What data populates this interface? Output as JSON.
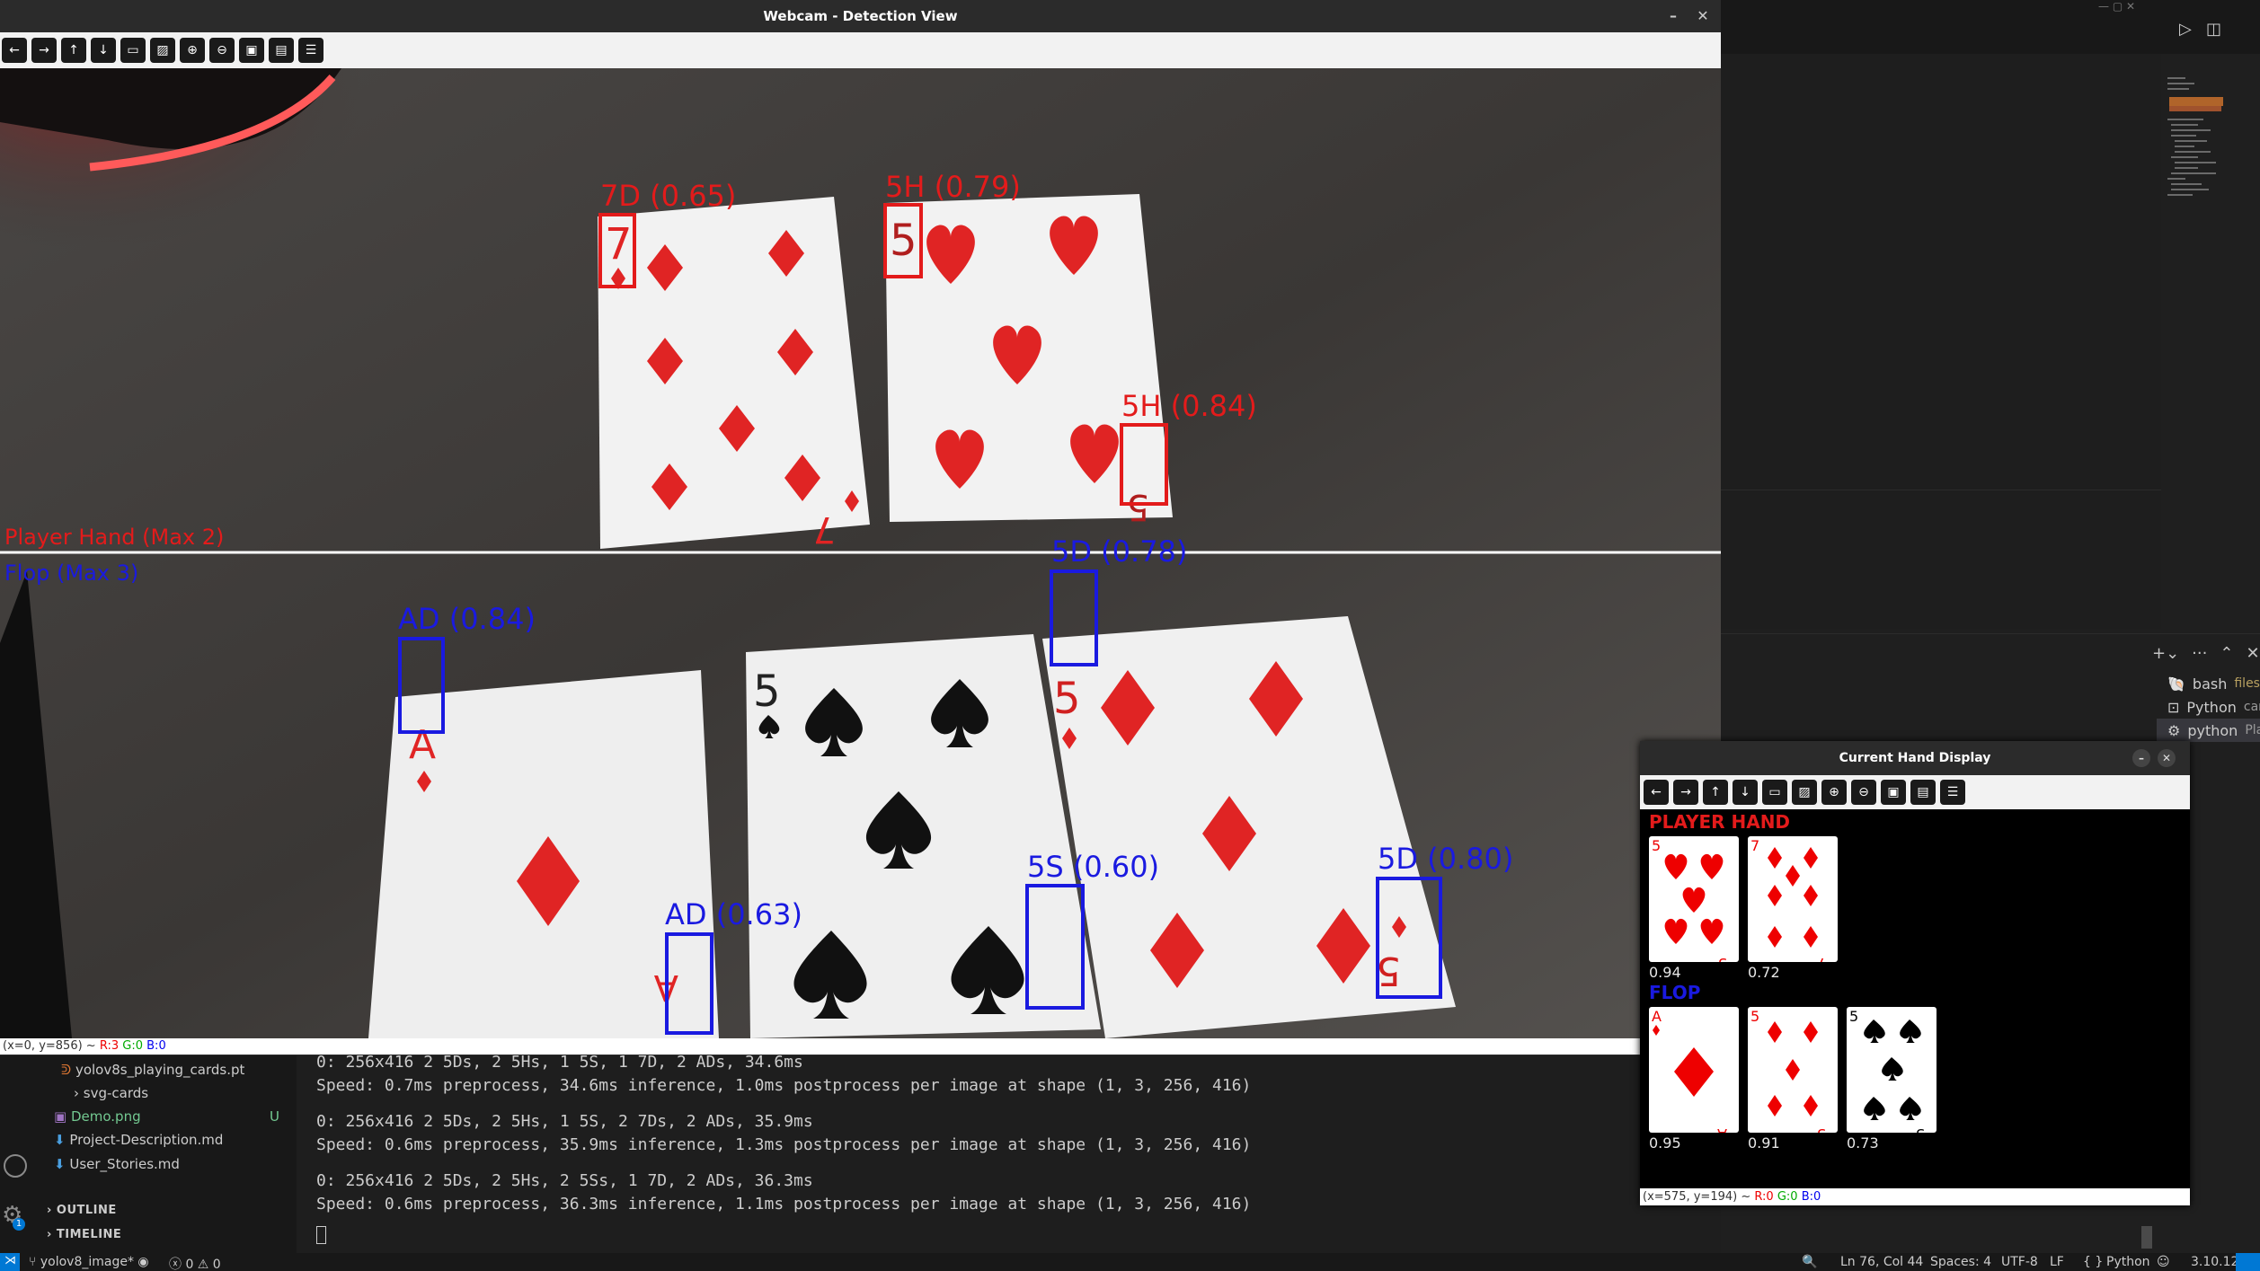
{
  "webcam_window": {
    "title": "Webcam - Detection View",
    "status_text": "(x=0, y=856) ~ ",
    "status_r": "R:3",
    "status_g": "G:0",
    "status_b": "B:0"
  },
  "zones": {
    "player": "Player Hand (Max 2)",
    "flop": "Flop (Max 3)"
  },
  "detections": {
    "d1": "7D (0.65)",
    "d2": "5H (0.79)",
    "d3": "5H (0.84)",
    "d4": "5D (0.78)",
    "d5": "AD (0.84)",
    "d6": "AD (0.63)",
    "d7": "5S (0.60)",
    "d8": "5D (0.80)"
  },
  "hand_window": {
    "title": "Current Hand Display",
    "player_label": "PLAYER HAND",
    "flop_label": "FLOP",
    "player_confs": [
      "0.94",
      "0.72"
    ],
    "flop_confs": [
      "0.95",
      "0.91",
      "0.73"
    ],
    "player_cards": [
      {
        "rank": "5",
        "suit": "hearts"
      },
      {
        "rank": "7",
        "suit": "diamonds"
      }
    ],
    "flop_cards": [
      {
        "rank": "A",
        "suit": "diamonds"
      },
      {
        "rank": "5",
        "suit": "diamonds"
      },
      {
        "rank": "5",
        "suit": "spades"
      }
    ],
    "status_text": "(x=575, y=194) ~ ",
    "status_r": "R:0",
    "status_g": "G:0",
    "status_b": "B:0"
  },
  "explorer": {
    "files": [
      "yolov8s_playing_cards.pt",
      "svg-cards",
      "Demo.png",
      "Project-Description.md",
      "User_Stories.md"
    ],
    "demo_badge": "U",
    "outline": "OUTLINE",
    "timeline": "TIMELINE"
  },
  "terminal": {
    "lines": [
      "0: 256x416 2 5Ds, 2 5Hs, 1 5S, 1 7D, 2 ADs, 34.6ms",
      "Speed: 0.7ms preprocess, 34.6ms inference, 1.0ms postprocess per image at shape (1, 3, 256, 416)",
      "0: 256x416 2 5Ds, 2 5Hs, 1 5S, 2 7Ds, 2 ADs, 35.9ms",
      "Speed: 0.6ms preprocess, 35.9ms inference, 1.3ms postprocess per image at shape (1, 3, 256, 416)",
      "0: 256x416 2 5Ds, 2 5Hs, 2 5Ss, 1 7D, 2 ADs, 36.3ms",
      "Speed: 0.6ms preprocess, 36.3ms inference, 1.1ms postprocess per image at shape (1, 3, 256, 416)"
    ],
    "tabs": [
      "bash",
      "files",
      "Python",
      "car...",
      "python",
      "Pla..."
    ]
  },
  "statusbar": {
    "branch": "yolov8_image*",
    "problems": "ⓧ 0 ⚠ 0",
    "position": "Ln 76, Col 44",
    "spaces": "Spaces: 4",
    "encoding": "UTF-8",
    "eol": "LF",
    "language": "Python",
    "version": "3.10.12",
    "braces": "{ }"
  },
  "colors": {
    "red_box": "#e31b1b",
    "blue_box": "#1a1ae0",
    "vscode_blue": "#0078d4"
  },
  "icons": [
    "arrow-left-icon",
    "arrow-right-icon",
    "arrow-up-icon",
    "arrow-down-icon",
    "fit-icon",
    "image-icon",
    "zoom-in-icon",
    "zoom-out-icon",
    "save-icon",
    "window-icon",
    "properties-icon"
  ]
}
